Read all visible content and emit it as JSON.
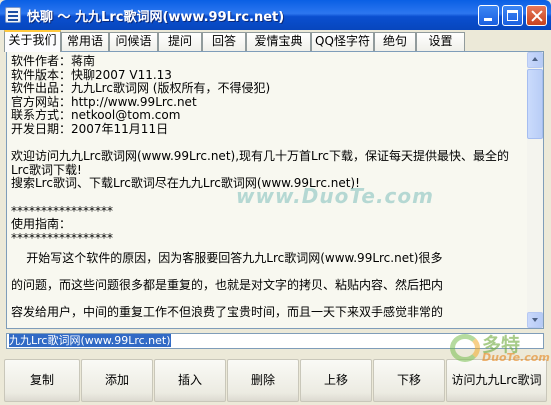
{
  "window": {
    "title": "快聊 ～ 九九Lrc歌词网(www.99Lrc.net)"
  },
  "tabs": [
    {
      "label": "关于我们",
      "active": true
    },
    {
      "label": "常用语"
    },
    {
      "label": "问候语"
    },
    {
      "label": "提问"
    },
    {
      "label": "回答"
    },
    {
      "label": "爱情宝典"
    },
    {
      "label": "QQ怪字符"
    },
    {
      "label": "绝句"
    },
    {
      "label": "设置"
    }
  ],
  "content": {
    "lines": [
      "软件作者：蒋南",
      "软件版本：快聊2007 V11.13",
      "软件出品：九九Lrc歌词网 (版权所有，不得侵犯)",
      "官方网站：http://www.99Lrc.net",
      "联系方式：netkool@tom.com",
      "开发日期：2007年11月11日",
      "",
      "欢迎访问九九Lrc歌词网(www.99Lrc.net),现有几十万首Lrc下载，保证每天提供最快、最全的Lrc歌词下载!",
      "搜索Lrc歌词、下载Lrc歌词尽在九九Lrc歌词网(www.99Lrc.net)!",
      "",
      "*****************",
      "使用指南：",
      "*****************",
      "    开始写这个软件的原因，因为客服要回答九九Lrc歌词网(www.99Lrc.net)很多",
      "的问题，而这些问题很多都是重复的，也就是对文字的拷贝、粘贴内容、然后把内",
      "容发给用户，中间的重复工作不但浪费了宝贵时间，而且一天下来双手感觉非常的"
    ]
  },
  "input": {
    "value": "九九Lrc歌词网(www.99Lrc.net)"
  },
  "buttons": [
    {
      "label": "复制"
    },
    {
      "label": "添加"
    },
    {
      "label": "插入"
    },
    {
      "label": "删除"
    },
    {
      "label": "上移"
    },
    {
      "label": "下移"
    },
    {
      "label": "访问九九Lrc歌词"
    }
  ],
  "watermarks": {
    "center": "www.DuoTe.com",
    "logo_main": "多特",
    "logo_sub": "DuoTe.com"
  }
}
